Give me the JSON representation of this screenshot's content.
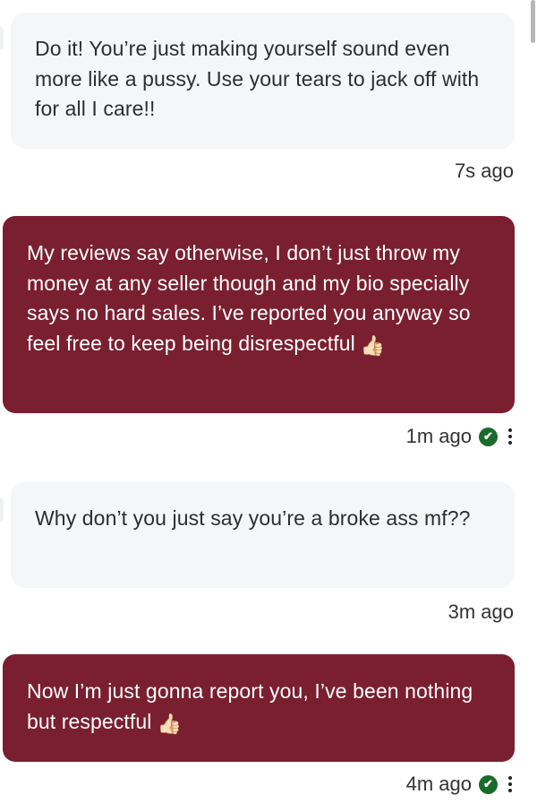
{
  "messages": [
    {
      "direction": "incoming",
      "text": "Do it! You’re just making yourself sound even more like a pussy. Use your tears to jack off with for all I care!!",
      "time": "7s ago"
    },
    {
      "direction": "outgoing",
      "text": "My reviews say otherwise, I don’t just throw my money at any seller though and my bio specially says no hard sales. I’ve reported you anyway so feel free to keep being disrespectful",
      "emoji": "👍🏻",
      "time": "1m ago",
      "status": "read"
    },
    {
      "direction": "incoming",
      "text": "Why don’t you just say you’re a broke ass mf??",
      "time": "3m ago"
    },
    {
      "direction": "outgoing",
      "text": "Now I’m just gonna report you, I’ve been nothing but respectful",
      "emoji": "👍🏻",
      "time": "4m ago",
      "status": "read"
    }
  ],
  "icons": {
    "read_check": "✔",
    "more_options": "more-vertical-icon"
  },
  "colors": {
    "outgoing_bubble": "#7a1f30",
    "incoming_bubble": "#f5f6f8",
    "read_badge": "#1a6b2b"
  }
}
